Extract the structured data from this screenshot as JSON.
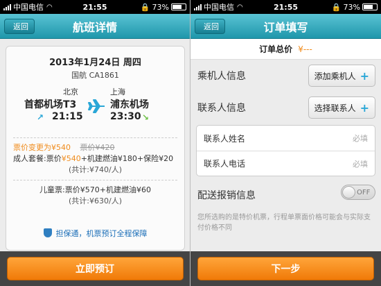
{
  "status": {
    "carrier": "中国电信",
    "time": "21:55",
    "battery": "73%",
    "battery_level": 0.73
  },
  "left": {
    "back": "返回",
    "title": "航班详情",
    "date": "2013年1月24日 周四",
    "flight_no": "国航 CA1861",
    "depart_city": "北京",
    "depart_airport": "首都机场T3",
    "depart_time": "21:15",
    "arrive_city": "上海",
    "arrive_airport": "浦东机场",
    "arrive_time": "23:30",
    "price_change": "票价变更为¥540",
    "old_price": "票价¥420",
    "adult_label": "成人套餐:",
    "adult_price_prefix": "票价",
    "adult_price": "¥540",
    "adult_extra": "+机建燃油¥180+保险¥20",
    "adult_total": "(共计:¥740/人)",
    "child_line": "儿童票:票价¥570+机建燃油¥60",
    "child_total": "(共计:¥630/人)",
    "guarantee": "担保通，机票预订全程保障",
    "book_button": "立即预订"
  },
  "right": {
    "back": "返回",
    "title": "订单填写",
    "total_label": "订单总价",
    "total_value": "¥---",
    "passenger_label": "乘机人信息",
    "add_passenger": "添加乘机人",
    "contact_label": "联系人信息",
    "select_contact": "选择联系人",
    "contact_name": "联系人姓名",
    "contact_phone": "联系人电话",
    "required": "必填",
    "delivery_label": "配送报销信息",
    "toggle_state": "OFF",
    "note": "您所选购的是特价机票，行程单票面价格可能会与实际支付价格不同",
    "next_button": "下一步"
  },
  "colors": {
    "nav": "#1f97ab",
    "accent": "#f08b1b",
    "link": "#1c6fb8"
  }
}
